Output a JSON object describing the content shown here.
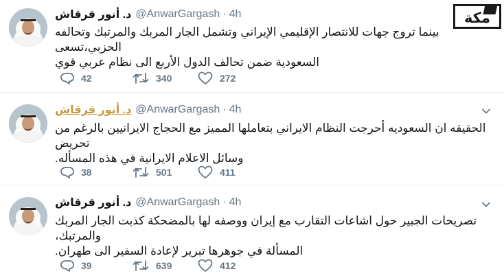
{
  "tweets": [
    {
      "name": "د. أنور قرقاش",
      "handle": "@AnwarGargash",
      "separator": "·",
      "time": "4h",
      "lines": [
        "بينما تروج جهات للانتصار الإقليمي الإيراني وتشمل الجار المربك والمرتبك وتحالفه الحزبي،تسعى",
        "السعودية ضمن تحالف الدول الأربع الى نظام عربي قوي"
      ],
      "replies": "42",
      "retweets": "340",
      "likes": "272"
    },
    {
      "name": "د. أنور قرقاش",
      "handle": "@AnwarGargash",
      "separator": "·",
      "time": "4h",
      "lines": [
        "الحقيقه ان السعوديه أحرجت النظام الايراني بتعاملها المميز مع الحجاج الايرانيين بالرغم من تحريض",
        "وسائل الاعلام الايرانية في هذه المسأله."
      ],
      "replies": "38",
      "retweets": "501",
      "likes": "411"
    },
    {
      "name": "د. أنور قرقاش",
      "handle": "@AnwarGargash",
      "separator": "·",
      "time": "4h",
      "lines": [
        "تصريحات الجبير حول اشاعات التقارب مع إيران ووصفه لها بالمضحكة كذبت الجار المربك والمرتبك،",
        "المسألة في جوهرها تبرير لإعادة السفير الى طهران."
      ],
      "replies": "39",
      "retweets": "639",
      "likes": "412"
    }
  ],
  "watermark": {
    "text": "مكة"
  },
  "icons": {
    "reply": "reply-icon",
    "retweet": "retweet-icon",
    "like": "heart-icon",
    "caret": "chevron-down-icon"
  },
  "colors": {
    "text": "#14171a",
    "muted": "#657786",
    "highlighted_name": "#c89b3c",
    "divider": "#e6ecf0"
  }
}
